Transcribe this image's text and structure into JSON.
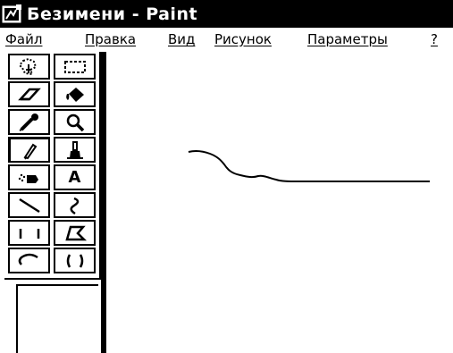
{
  "window": {
    "title": "Безимени - Paint"
  },
  "menu": {
    "items": [
      {
        "label": "Файл"
      },
      {
        "label": "Правка"
      },
      {
        "label": "Вид"
      },
      {
        "label": "Рисунок"
      },
      {
        "label": "Параметры"
      },
      {
        "label": "?"
      }
    ]
  },
  "toolbox": {
    "tools": [
      {
        "icon": "free-select-icon"
      },
      {
        "icon": "rect-select-icon"
      },
      {
        "icon": "eraser-icon"
      },
      {
        "icon": "fill-icon"
      },
      {
        "icon": "eyedropper-icon"
      },
      {
        "icon": "magnifier-icon"
      },
      {
        "icon": "pencil-icon",
        "pressed": true
      },
      {
        "icon": "brush-icon"
      },
      {
        "icon": "airbrush-icon"
      },
      {
        "icon": "text-icon",
        "label": "A"
      },
      {
        "icon": "line-icon"
      },
      {
        "icon": "curve-icon"
      },
      {
        "icon": "rectangle-icon"
      },
      {
        "icon": "polygon-icon"
      },
      {
        "icon": "ellipse-icon"
      },
      {
        "icon": "rounded-rect-icon"
      }
    ]
  },
  "colors": {
    "titlebar": "#000000",
    "title_text": "#ffffff",
    "canvas": "#ffffff",
    "stroke": "#000000"
  }
}
